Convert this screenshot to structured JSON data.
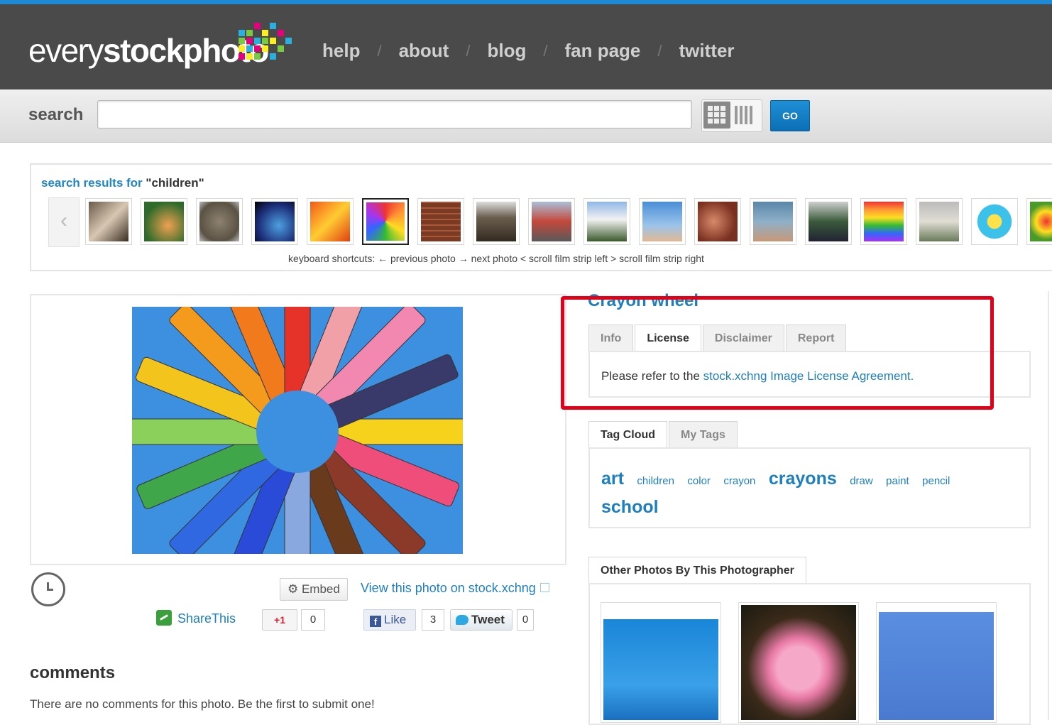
{
  "header": {
    "logo_thin": "every",
    "logo_bold": "stockphoto",
    "nav": [
      "help",
      "about",
      "blog",
      "fan page",
      "twitter"
    ],
    "nav_separator": "/"
  },
  "search": {
    "label": "search",
    "value": "",
    "go_label": "GO"
  },
  "strip": {
    "title_prefix": "search results for ",
    "query": "\"children\"",
    "prev_glyph": "‹",
    "shortcuts": "keyboard shortcuts: ← previous photo → next photo < scroll film strip left > scroll film strip right"
  },
  "photo": {
    "title": "Crayon wheel"
  },
  "license_tabs": [
    "Info",
    "License",
    "Disclaimer",
    "Report"
  ],
  "license": {
    "prefix": "Please refer to the ",
    "link": "stock.xchng Image License Agreement."
  },
  "tag_tabs": [
    "Tag Cloud",
    "My Tags"
  ],
  "tags": [
    {
      "text": "art",
      "size": "lg"
    },
    {
      "text": "children",
      "size": "sm"
    },
    {
      "text": "color",
      "size": "sm"
    },
    {
      "text": "crayon",
      "size": "sm"
    },
    {
      "text": "crayons",
      "size": "lg"
    },
    {
      "text": "draw",
      "size": "sm"
    },
    {
      "text": "paint",
      "size": "sm"
    },
    {
      "text": "pencil",
      "size": "sm"
    },
    {
      "text": "school",
      "size": "lg"
    }
  ],
  "other_photos_tab": "Other Photos By This Photographer",
  "actions": {
    "embed": "Embed",
    "view_link": "View this photo on stock.xchng",
    "share": "ShareThis",
    "gplus": "+1",
    "gplus_count": "0",
    "like": "Like",
    "like_count": "3",
    "tweet": "Tweet",
    "tweet_count": "0"
  },
  "comments": {
    "heading": "comments",
    "empty": "There are no comments for this photo. Be the first to submit one!"
  },
  "colors": {
    "accent": "#1e7fbf",
    "header_bg": "#4a4a4a",
    "highlight": "#e5001a"
  }
}
